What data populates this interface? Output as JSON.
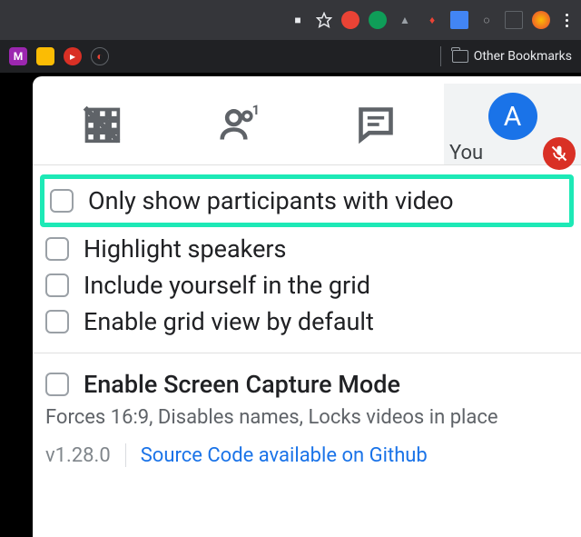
{
  "bookmarks": {
    "other_bookmarks_label": "Other Bookmarks"
  },
  "meet": {
    "you_label": "You",
    "avatar_letter": "A",
    "options": [
      {
        "label": "Only show participants with video",
        "highlighted": true
      },
      {
        "label": "Highlight speakers",
        "highlighted": false
      },
      {
        "label": "Include yourself in the grid",
        "highlighted": false
      },
      {
        "label": "Enable grid view by default",
        "highlighted": false
      }
    ],
    "capture": {
      "label": "Enable Screen Capture Mode",
      "description": "Forces 16:9, Disables names, Locks videos in place"
    },
    "version": "v1.28.0",
    "source_link": "Source Code available on Github"
  }
}
